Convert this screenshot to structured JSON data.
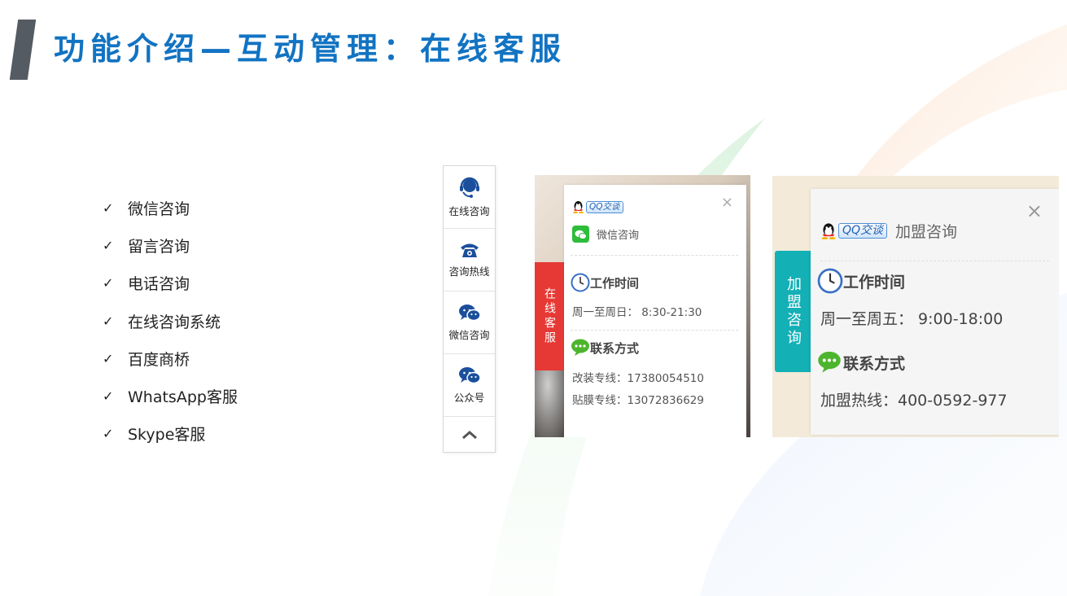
{
  "slide": {
    "title": "功能介绍—互动管理：在线客服"
  },
  "features": [
    "微信咨询",
    "留言咨询",
    "电话咨询",
    "在线咨询系统",
    "百度商桥",
    "WhatsApp客服",
    "Skype客服"
  ],
  "check_glyph": "✓",
  "sidebar": {
    "items": [
      {
        "label": "在线咨询",
        "icon": "headset-icon"
      },
      {
        "label": "咨询热线",
        "icon": "phone-icon"
      },
      {
        "label": "微信咨询",
        "icon": "wechat-icon"
      },
      {
        "label": "公众号",
        "icon": "wechat-icon"
      }
    ],
    "top_icon": "chevron-up-icon"
  },
  "panel1": {
    "tab_label": "在线客服",
    "qq_label": "QQ交谈",
    "wechat_label": "微信咨询",
    "close_glyph": "×",
    "work_time_title": "工作时间",
    "work_time": "周一至周日： 8:30-21:30",
    "contact_title": "联系方式",
    "contact_lines": [
      "改装专线：17380054510",
      "贴膜专线：13072836629"
    ]
  },
  "panel2": {
    "tab_label": "加盟咨询",
    "qq_label": "QQ交谈",
    "qq_name": "加盟咨询",
    "close_glyph": "×",
    "work_time_title": "工作时间",
    "work_time": "周一至周五： 9:00-18:00",
    "contact_title": "联系方式",
    "contact_line": "加盟热线：400-0592-977"
  },
  "colors": {
    "title_blue": "#1273c2",
    "tab_red": "#e63935",
    "tab_teal": "#13b0b5",
    "wechat_green": "#2dbc3b",
    "icon_navy": "#1b4f9c"
  }
}
